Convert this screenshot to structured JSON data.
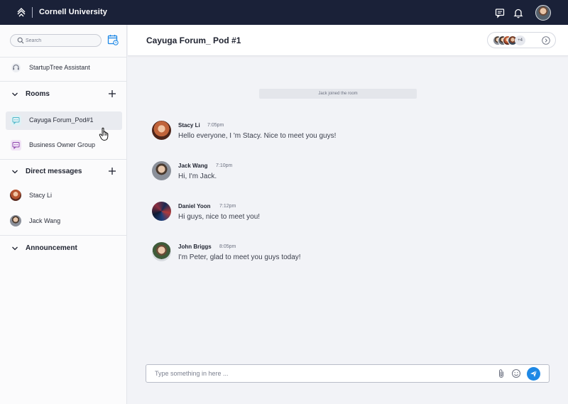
{
  "header": {
    "brand": "Cornell University",
    "icons": [
      "logo-icon",
      "chat-icon",
      "bell-icon",
      "user-avatar"
    ]
  },
  "sidebar": {
    "search": {
      "placeholder": "Search"
    },
    "pinned": {
      "label": "StartupTree Assistant",
      "icon": "headset-icon"
    },
    "rooms": {
      "title": "Rooms",
      "items": [
        {
          "label": "Cayuga Forum_Pod#1",
          "icon": "chat-bubble-icon",
          "color": "#4fb7c9",
          "active": true
        },
        {
          "label": "Business Owner Group",
          "icon": "chat-bubble-icon",
          "color": "#8e44ad",
          "active": false
        }
      ]
    },
    "direct_messages": {
      "title": "Direct messages",
      "items": [
        {
          "label": "Stacy Li"
        },
        {
          "label": "Jack Wang"
        }
      ]
    },
    "announcement": {
      "title": "Announcement"
    }
  },
  "chat": {
    "title": "Cayuga Forum_ Pod #1",
    "members_extra": "+4",
    "system_message": "Jack joined the room",
    "messages": [
      {
        "name": "Stacy Li",
        "time": "7:05pm",
        "text": "Hello everyone, I 'm Stacy. Nice to meet you guys!"
      },
      {
        "name": "Jack Wang",
        "time": "7:10pm",
        "text": "Hi, I'm Jack."
      },
      {
        "name": "Daniel Yoon",
        "time": "7:12pm",
        "text": "Hi guys, nice to meet you!"
      },
      {
        "name": "John Briggs",
        "time": "8:05pm",
        "text": "I'm Peter, glad to meet you guys today!"
      }
    ],
    "composer": {
      "placeholder": "Type something in here ..."
    }
  },
  "colors": {
    "topbar": "#1a2138",
    "accent": "#1e88e5",
    "room_teal": "#4fb7c9",
    "room_purple": "#8e44ad"
  }
}
